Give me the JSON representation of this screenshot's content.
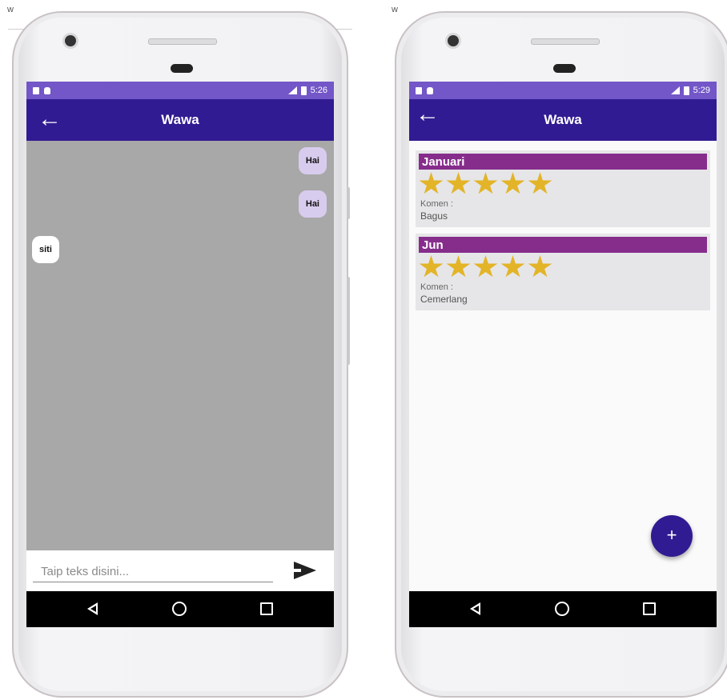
{
  "left_phone": {
    "status_time": "5:26",
    "title": "Wawa",
    "messages": [
      {
        "text": "Hai",
        "side": "out"
      },
      {
        "text": "Hai",
        "side": "out"
      },
      {
        "text": "siti",
        "side": "in"
      }
    ],
    "input_placeholder": "Taip teks disini..."
  },
  "right_phone": {
    "status_time": "5:29",
    "title": "Wawa",
    "reviews": [
      {
        "month": "Januari",
        "stars": 5,
        "comment_label": "Komen :",
        "comment": "Bagus"
      },
      {
        "month": "Jun",
        "stars": 5,
        "comment_label": "Komen :",
        "comment": "Cemerlang"
      }
    ],
    "fab_label": "+"
  },
  "colors": {
    "status_bar": "#7356c7",
    "app_bar": "#311b92",
    "chat_background": "#a8a8a8",
    "outgoing_bubble": "#d8ccee",
    "card_header": "#862d8c",
    "star": "#e3b428"
  }
}
